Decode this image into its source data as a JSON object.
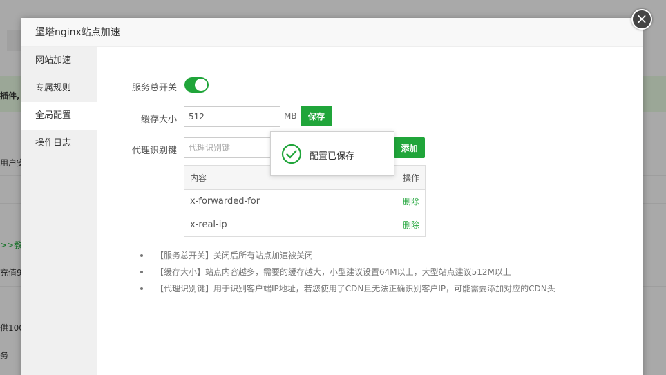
{
  "background": {
    "row1": "插件,",
    "row2": "用户安",
    "row3": ">>教",
    "row4": "充值9",
    "row5": "供100",
    "row6": "务"
  },
  "modal": {
    "title": "堡塔nginx站点加速",
    "close_glyph": "×"
  },
  "sidebar": {
    "items": [
      {
        "label": "网站加速"
      },
      {
        "label": "专属规则"
      },
      {
        "label": "全局配置"
      },
      {
        "label": "操作日志"
      }
    ]
  },
  "form": {
    "switch_label": "服务总开关",
    "switch_on": true,
    "cache_label": "缓存大小",
    "cache_value": "512",
    "cache_unit": "MB",
    "save_label": "保存",
    "proxy_label": "代理识别键",
    "proxy_placeholder": "代理识别键",
    "add_label": "添加"
  },
  "table": {
    "headers": {
      "content": "内容",
      "action": "操作"
    },
    "rows": [
      {
        "content": "x-forwarded-for",
        "action": "删除"
      },
      {
        "content": "x-real-ip",
        "action": "删除"
      }
    ]
  },
  "tips": [
    "【服务总开关】关闭后所有站点加速被关闭",
    "【缓存大小】站点内容越多，需要的缓存越大，小型建议设置64M以上，大型站点建议512M以上",
    "【代理识别键】用于识别客户端IP地址，若您使用了CDN且无法正确识别客户IP，可能需要添加对应的CDN头"
  ],
  "toast": {
    "message": "配置已保存",
    "icon": "check-circle-icon"
  },
  "colors": {
    "accent": "#20a53a"
  }
}
